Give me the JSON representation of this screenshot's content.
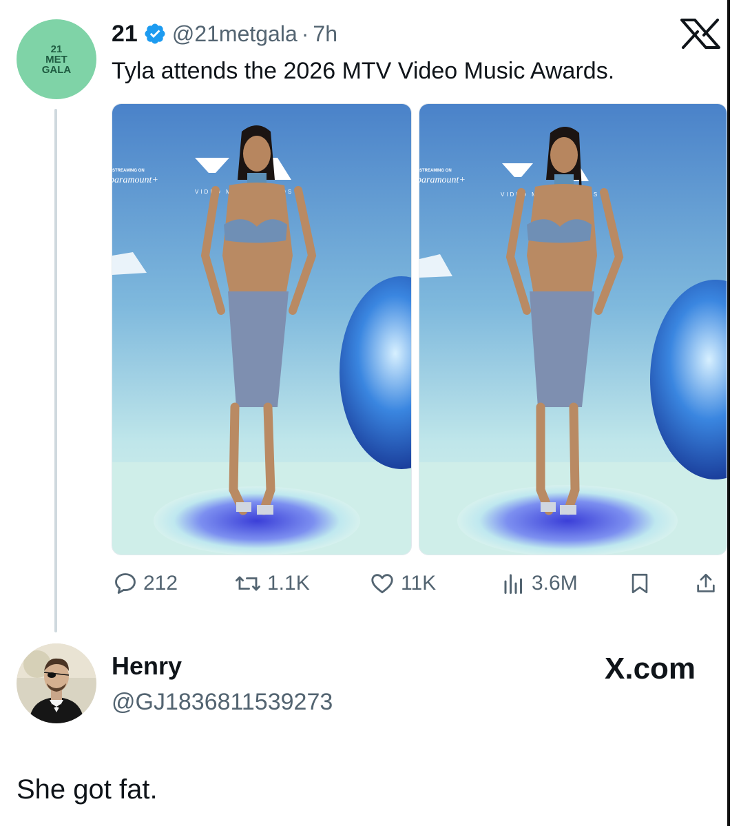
{
  "tweet": {
    "avatar_text": [
      "21",
      "MET",
      "GALA"
    ],
    "display_name": "21",
    "handle": "@21metgala",
    "separator": "·",
    "time": "7h",
    "text": "Tyla attends the 2026 MTV Video Music Awards.",
    "photos": [
      {
        "backdrop_text": [
          "STREAMING ON",
          "paramount+",
          "VIDEO MUSIC AWARDS"
        ]
      },
      {
        "backdrop_text": [
          "STREAMING ON",
          "paramount+",
          "VIDEO MUSIC AWARDS"
        ]
      }
    ]
  },
  "actions": {
    "replies": "212",
    "reposts": "1.1K",
    "likes": "11K",
    "views": "3.6M"
  },
  "reply": {
    "name": "Henry",
    "handle": "@GJ1836811539273",
    "watermark": "X.com",
    "text": "She got fat."
  },
  "icons": {
    "verified": "verified-badge-icon",
    "x_logo": "x-logo-icon",
    "reply": "comment-icon",
    "repost": "repost-icon",
    "like": "heart-icon",
    "views": "views-chart-icon",
    "bookmark": "bookmark-icon",
    "share": "share-icon"
  },
  "colors": {
    "verified_blue": "#1d9bf0",
    "secondary_text": "#536471",
    "avatar_green": "#7fd3a7"
  }
}
